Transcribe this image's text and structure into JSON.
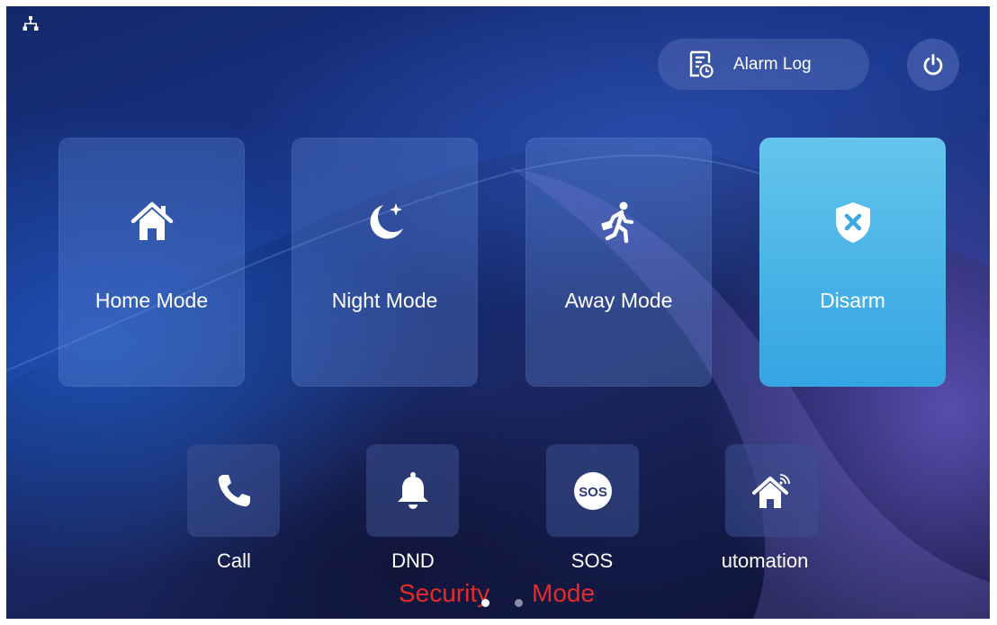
{
  "status_bar": {
    "network_icon": "network-icon"
  },
  "alarm_log": {
    "icon": "alarm-log-icon",
    "label": "Alarm Log"
  },
  "power": {
    "icon": "power-icon"
  },
  "modes": [
    {
      "label": "Home Mode",
      "icon": "home-icon",
      "active": false
    },
    {
      "label": "Night Mode",
      "icon": "moon-star-icon",
      "active": false
    },
    {
      "label": "Away Mode",
      "icon": "running-man-icon",
      "active": false
    },
    {
      "label": "Disarm",
      "icon": "shield-x-icon",
      "active": true
    }
  ],
  "quick_actions": [
    {
      "label": "Call",
      "icon": "phone-icon"
    },
    {
      "label": "DND",
      "icon": "bell-icon"
    },
    {
      "label": "SOS",
      "icon": "sos-icon",
      "icon_text": "SOS"
    },
    {
      "label": "utomation",
      "icon": "smart-home-icon"
    }
  ],
  "caption": {
    "left": "Security",
    "right": "Mode"
  },
  "pagination": {
    "pages": 2,
    "current": 1
  },
  "colors": {
    "active_card": "#3fb0e6",
    "caption": "#e82a2a",
    "background": "#13266b"
  }
}
